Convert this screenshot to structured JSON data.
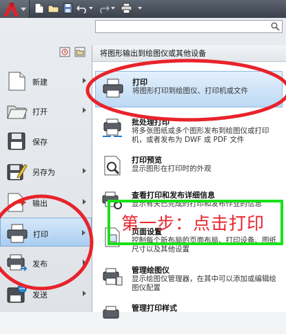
{
  "quick_access": {
    "icons": [
      "new-file-icon",
      "open-folder-icon",
      "save-icon",
      "undo-icon",
      "redo-icon",
      "print-icon"
    ]
  },
  "search": {
    "value": "",
    "placeholder": ""
  },
  "left_menu": {
    "items": [
      {
        "label": "新建",
        "icon": "new-document-icon",
        "has_submenu": true
      },
      {
        "label": "打开",
        "icon": "open-folder-icon",
        "has_submenu": true
      },
      {
        "label": "保存",
        "icon": "save-icon",
        "has_submenu": false
      },
      {
        "label": "另存为",
        "icon": "save-as-icon",
        "has_submenu": true
      },
      {
        "label": "输出",
        "icon": "export-icon",
        "has_submenu": true
      },
      {
        "label": "打印",
        "icon": "printer-icon",
        "has_submenu": true,
        "active": true
      },
      {
        "label": "发布",
        "icon": "publish-icon",
        "has_submenu": true
      },
      {
        "label": "发送",
        "icon": "send-icon",
        "has_submenu": true
      }
    ]
  },
  "submenu": {
    "header": "将图形输出到绘图仪或其他设备",
    "items": [
      {
        "title": "打印",
        "desc": "将图形打印到绘图仪、打印机或文件",
        "icon": "printer-icon",
        "active": true
      },
      {
        "title": "批处理打印",
        "desc": "将多张图纸或多个图形发布到绘图仪或打印机，或者发布为 DWF 或 PDF 文件",
        "icon": "batch-plot-icon"
      },
      {
        "title": "打印预览",
        "desc": "显示图形在打印时的外观",
        "icon": "preview-icon"
      },
      {
        "title": "查看打印和发布详细信息",
        "desc": "显示有关已完成的打印和发布作业的信息",
        "icon": "plot-details-icon"
      },
      {
        "title": "页面设置",
        "desc": "控制每个新布局的页面布局、打印设备、图纸尺寸以及其他设置",
        "icon": "page-setup-icon"
      },
      {
        "title": "管理绘图仪",
        "desc": "显示绘图仪管理器，在其中可以添加或编辑绘图仪配置",
        "icon": "plotter-manager-icon"
      },
      {
        "title": "管理打印样式",
        "desc": "",
        "icon": "plot-style-icon"
      }
    ]
  },
  "annotation": {
    "step_text": "第一步：点击打印",
    "ellipse_color": "#e8232b",
    "box_color": "#18e018"
  }
}
